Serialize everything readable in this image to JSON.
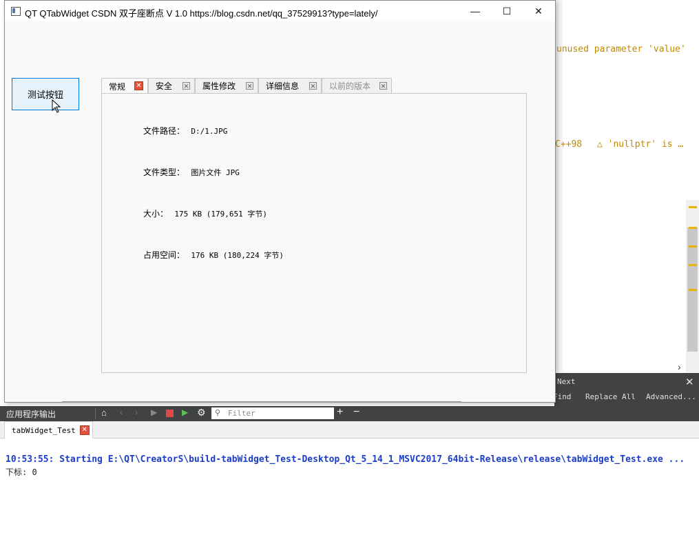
{
  "editor": {
    "warnings": [
      {
        "text": "unused parameter 'value'"
      },
      {
        "prefix": "C++98",
        "icon": "warning-triangle-icon",
        "text": "'nullptr' is …"
      }
    ],
    "accent_warning": "#e8b400"
  },
  "find_bar": {
    "next_label": "Next",
    "find_label": "Find",
    "replace_all_label": "Replace All",
    "advanced_label": "Advanced..."
  },
  "output": {
    "toolbar_title": "应用程序输出",
    "filter_placeholder": "Filter",
    "tab_label": "tabWidget_Test",
    "log": [
      "10:53:55: Starting E:\\QT\\CreatorS\\build-tabWidget_Test-Desktop_Qt_5_14_1_MSVC2017_64bit-Release\\release\\tabWidget_Test.exe ...",
      "下标: 0"
    ]
  },
  "window": {
    "title": "QT QTabWidget  CSDN 双子座断点 V 1.0 https://blog.csdn.net/qq_37529913?type=lately/",
    "minimize_glyph": "—",
    "maximize_glyph": "☐",
    "close_glyph": "✕"
  },
  "test_button_label": "测试按钮",
  "tabs": [
    {
      "label": "常规",
      "active": true
    },
    {
      "label": "安全"
    },
    {
      "label": "属性修改"
    },
    {
      "label": "详细信息"
    },
    {
      "label": "以前的版本",
      "disabled": true
    }
  ],
  "general": {
    "path_label": "文件路径：",
    "path_value": "D:/1.JPG",
    "type_label": "文件类型：",
    "type_value": "图片文件 JPG",
    "size_label": "大小：",
    "size_value": "175 KB (179,651 字节)",
    "disk_label": "占用空间：",
    "disk_value": "176 KB (180,224 字节)"
  }
}
